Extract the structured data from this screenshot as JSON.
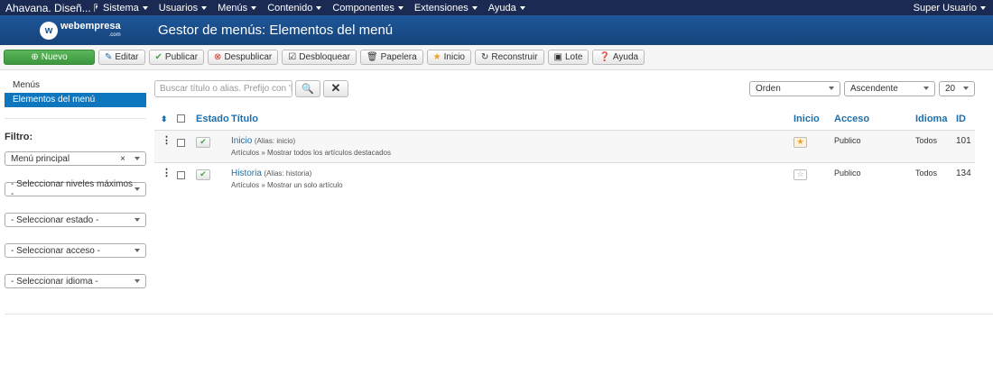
{
  "topbar": {
    "site": "Ahavana. Diseñ...",
    "menu": [
      "Sistema",
      "Usuarios",
      "Menús",
      "Contenido",
      "Componentes",
      "Extensiones",
      "Ayuda"
    ],
    "user": "Super Usuario"
  },
  "header": {
    "logo": "webempresa",
    "logo_sub": ".com",
    "title": "Gestor de menús: Elementos del menú"
  },
  "toolbar": {
    "new": "Nuevo",
    "edit": "Editar",
    "publish": "Publicar",
    "unpublish": "Despublicar",
    "unlock": "Desbloquear",
    "trash": "Papelera",
    "home": "Inicio",
    "rebuild": "Reconstruir",
    "batch": "Lote",
    "help": "Ayuda"
  },
  "sidebar": {
    "items": [
      "Menús",
      "Elementos del menú"
    ],
    "filter_label": "Filtro:",
    "filters": [
      "Menú principal",
      "- Seleccionar niveles máximos -",
      "- Seleccionar estado -",
      "- Seleccionar acceso -",
      "- Seleccionar idioma -"
    ]
  },
  "search": {
    "placeholder": "Buscar título o alias. Prefijo con 'ID:'"
  },
  "sort": {
    "order": "Orden",
    "direction": "Ascendente",
    "limit": "20"
  },
  "table": {
    "headers": {
      "state": "Estado",
      "title": "Título",
      "home": "Inicio",
      "access": "Acceso",
      "language": "Idioma",
      "id": "ID"
    },
    "rows": [
      {
        "title": "Inicio",
        "alias": "(Alias: inicio)",
        "type": "Artículos » Mostrar todos los artículos destacados",
        "home": true,
        "access": "Publico",
        "language": "Todos",
        "id": "101"
      },
      {
        "title": "Historia",
        "alias": "(Alias: historia)",
        "type": "Artículos » Mostrar un solo artículo",
        "home": false,
        "access": "Publico",
        "language": "Todos",
        "id": "134"
      }
    ]
  },
  "colors": {
    "topbar": "#1a2a52",
    "header": "#1e5799",
    "accent": "#0e76bc",
    "new_button": "#5bb75b"
  }
}
